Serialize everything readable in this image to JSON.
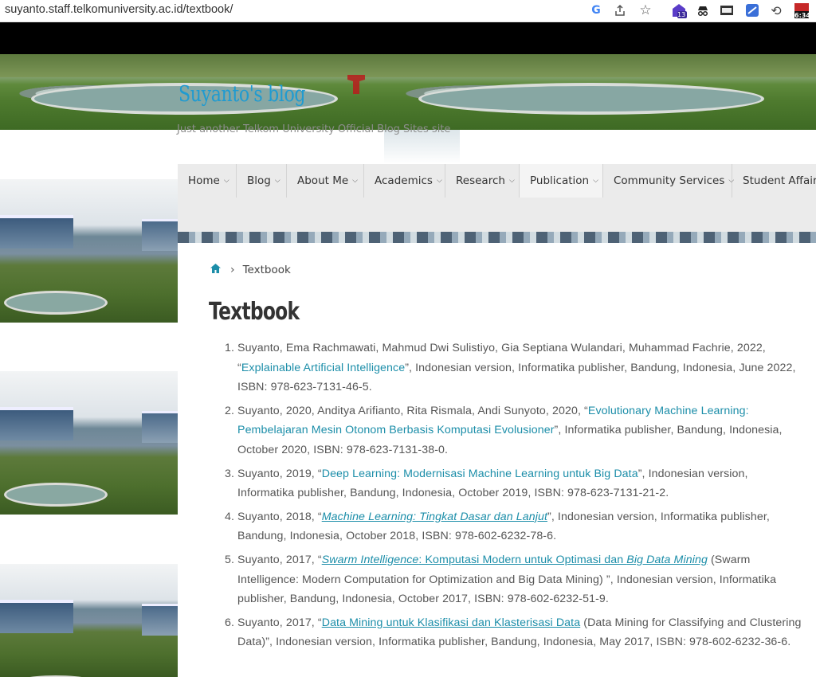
{
  "browser": {
    "url": "suyanto.staff.telkomuniversity.ac.id/textbook/",
    "ext_badge_1": "13",
    "ext_badge_2": "6:34"
  },
  "site": {
    "title": "Suyanto's blog",
    "tagline": "Just another Telkom University Official Blog Sites site"
  },
  "nav": {
    "items": [
      {
        "label": "Home"
      },
      {
        "label": "Blog"
      },
      {
        "label": "About Me"
      },
      {
        "label": "Academics"
      },
      {
        "label": "Research"
      },
      {
        "label": "Publication"
      },
      {
        "label": "Community Services"
      },
      {
        "label": "Student Affairs"
      }
    ]
  },
  "breadcrumb": {
    "current": "Textbook"
  },
  "page": {
    "title": "Textbook"
  },
  "books": [
    {
      "num": "1.",
      "pre": "Suyanto, Ema Rachmawati, Mahmud Dwi Sulistiyo, Gia Septiana Wulandari, Muhammad Fachrie, 2022, “",
      "link": "Explainable Artificial Intelligence",
      "post": "”, Indonesian version, Informatika publisher, Bandung, Indonesia, June 2022, ISBN: 978-623-7131-46-5."
    },
    {
      "num": "2.",
      "pre": "Suyanto, 2020, Anditya Arifianto, Rita Rismala, Andi Sunyoto, 2020, “",
      "link": "Evolutionary Machine Learning: Pembelajaran Mesin Otonom Berbasis Komputasi Evolusioner",
      "post": "”, Informatika publisher, Bandung, Indonesia, October 2020, ISBN: 978-623-7131-38-0."
    },
    {
      "num": "3.",
      "pre": "Suyanto, 2019, “",
      "link": "Deep Learning: Modernisasi Machine Learning untuk Big Data",
      "post": "”, Indonesian version, Informatika publisher, Bandung, Indonesia, October 2019, ISBN: 978-623-7131-21-2."
    },
    {
      "num": "4.",
      "pre": "Suyanto, 2018, “",
      "link": "Machine Learning: Tingkat Dasar dan Lanjut",
      "post": "”, Indonesian version, Informatika publisher, Bandung, Indonesia, October 2018, ISBN: 978-602-6232-78-6."
    },
    {
      "num": "5.",
      "pre": "Suyanto, 2017, “",
      "link_a": "Swarm Intelligence",
      "link_b": ": Komputasi Modern untuk Optimasi dan ",
      "link_c": "Big Data Mining",
      "post": " (Swarm Intelligence: Modern Computation for Optimization and Big Data Mining) ”, Indonesian version, Informatika publisher, Bandung, Indonesia, October 2017, ISBN: 978-602-6232-51-9."
    },
    {
      "num": "6.",
      "pre": "Suyanto, 2017, “",
      "link": "Data Mining untuk Klasifikasi dan Klasterisasi Data",
      "post": " (Data Mining for Classifying and Clustering Data)”, Indonesian version, Informatika publisher, Bandung, Indonesia, May 2017, ISBN: 978-602-6232-36-6."
    }
  ],
  "colors": {
    "link": "#1c8ea9",
    "site_title": "#1f9bd1",
    "nav_bg": "#ebebeb"
  },
  "icons": [
    "google-icon",
    "share-icon",
    "star-icon",
    "home-icon",
    "chevron-down-icon"
  ]
}
